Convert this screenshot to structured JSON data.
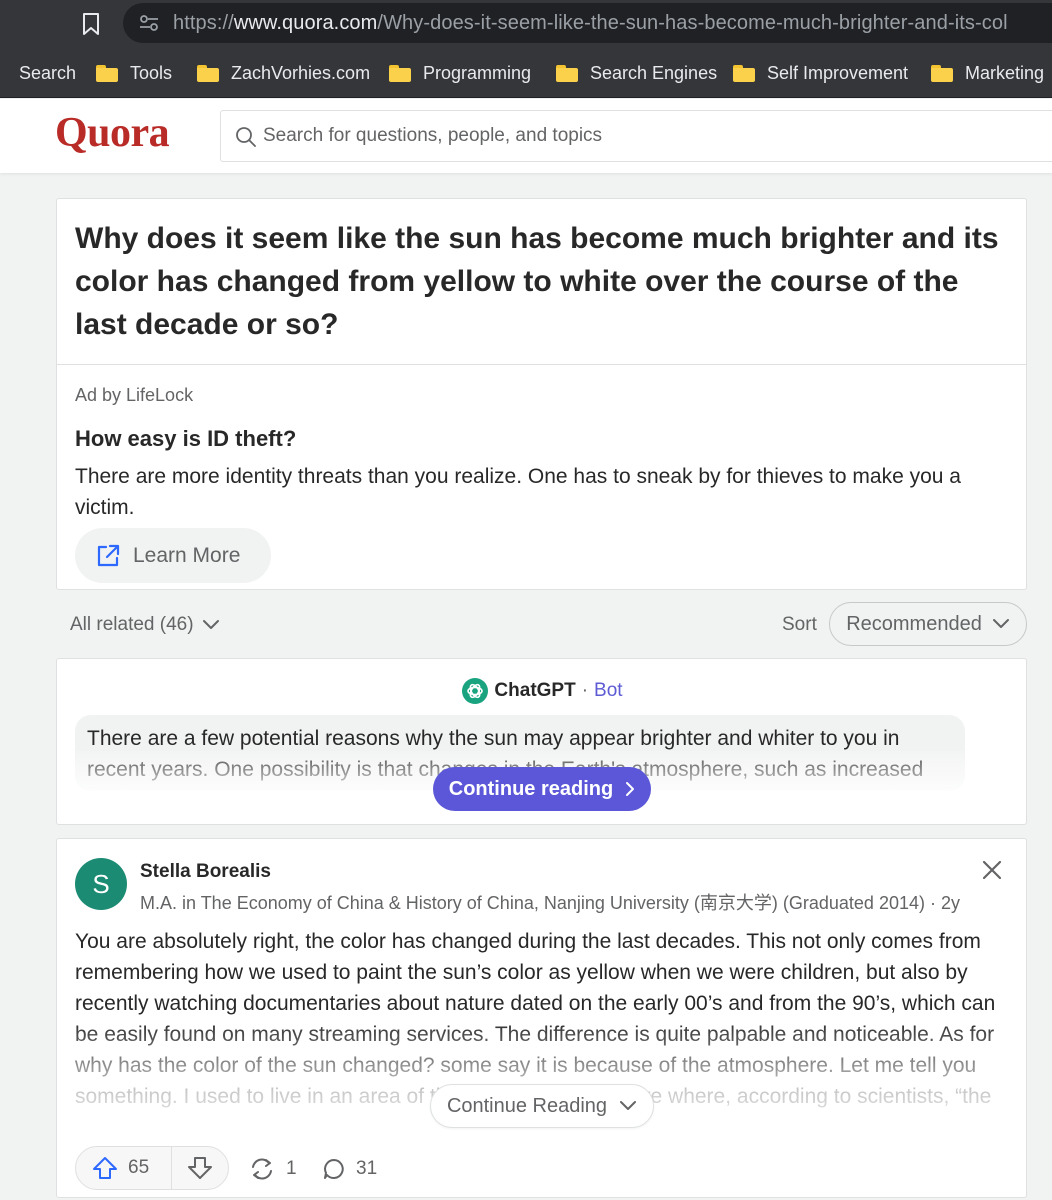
{
  "browser": {
    "url_prefix": "https://",
    "url_host": "www.quora.com",
    "url_path": "/Why-does-it-seem-like-the-sun-has-become-much-brighter-and-its-col",
    "bookmarks": [
      "Search",
      "Tools",
      "ZachVorhies.com",
      "Programming",
      "Search Engines",
      "Self Improvement",
      "Marketing"
    ]
  },
  "header": {
    "logo": "Quora",
    "search_placeholder": "Search for questions, people, and topics"
  },
  "question": {
    "title": "Why does it seem like the sun has become much brighter and its color has changed from yellow to white over the course of the last decade or so?"
  },
  "ad": {
    "label": "Ad by LifeLock",
    "title": "How easy is ID theft?",
    "body": "There are more identity threats than you realize. One has to sneak by for thieves to make you a victim.",
    "cta": "Learn More"
  },
  "related": {
    "label": "All related (46)",
    "sort_label": "Sort",
    "sort_value": "Recommended"
  },
  "bot_answer": {
    "name": "ChatGPT",
    "separator": "·",
    "tag": "Bot",
    "text": "There are a few potential reasons why the sun may appear brighter and whiter to you in recent years. One possibility is that changes in the Earth's atmosphere, such as increased",
    "continue_label": "Continue reading"
  },
  "answer": {
    "avatar_letter": "S",
    "author": "Stella Borealis",
    "credential": "M.A. in The Economy of China & History of China, Nanjing University (南京大学) (Graduated 2014) · 2y",
    "text": "You are absolutely right, the color has changed during the last decades. This not only comes from remembering how we used to paint the sun’s color as yellow when we were children, but also by recently watching documentaries about nature dated on the early 00’s and from the 90’s, which can be easily found on many streaming services. The difference is quite palpable and noticeable. As for why has the color of the sun changed? some say it is because of the atmosphere. Let me tell you something. I used to live in an area of the southern hemisphere where, according to scientists, “the",
    "continue_label": "Continue Reading",
    "upvotes": "65",
    "shares": "1",
    "comments": "31"
  },
  "colors": {
    "brand": "#b92b27",
    "bot_accent": "#5b57d8",
    "avatar": "#1c8b73",
    "link_blue": "#2e69ff"
  },
  "icons": [
    "bookmark-icon",
    "site-info-icon",
    "folder-icon",
    "search-icon",
    "external-link-icon",
    "chevron-down-icon",
    "chatgpt-logo-icon",
    "chevron-right-icon",
    "close-icon",
    "upvote-icon",
    "downvote-icon",
    "share-icon",
    "comment-icon"
  ]
}
